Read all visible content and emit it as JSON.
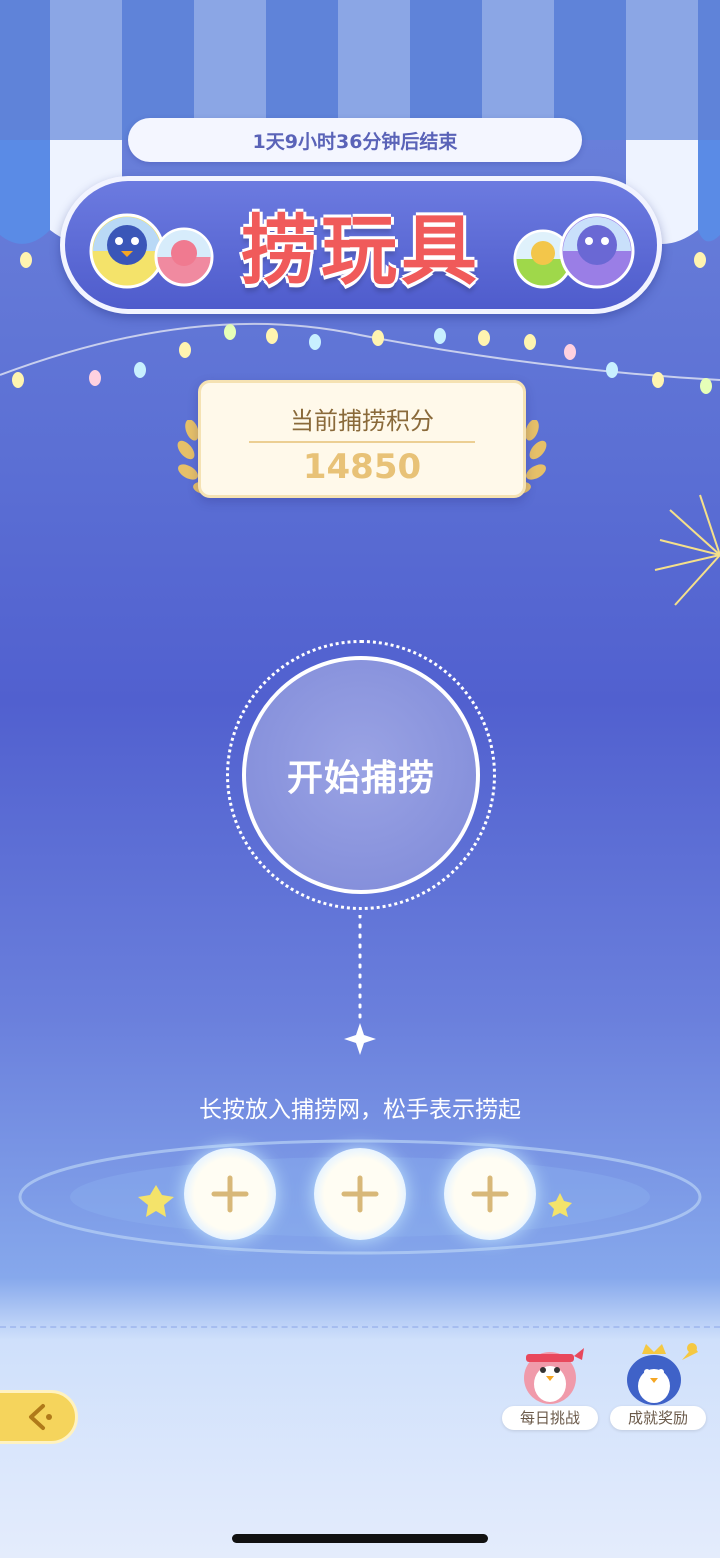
{
  "timer": {
    "text": "1天9小时36分钟后结束"
  },
  "banner": {
    "title": "捞玩具"
  },
  "score": {
    "label": "当前捕捞积分",
    "value": "14850"
  },
  "start_button": {
    "label": "开始捕捞"
  },
  "hint": {
    "text": "长按放入捕捞网，松手表示捞起"
  },
  "slots": [
    {
      "icon": "plus-icon"
    },
    {
      "icon": "plus-icon"
    },
    {
      "icon": "plus-icon"
    }
  ],
  "features": [
    {
      "label": "每日挑战",
      "icon": "penguin-headband-icon"
    },
    {
      "label": "成就奖励",
      "icon": "penguin-crown-icon"
    }
  ],
  "colors": {
    "accent": "#f05a5a",
    "score_gold": "#e8c277",
    "tab_yellow": "#f5d45c"
  }
}
